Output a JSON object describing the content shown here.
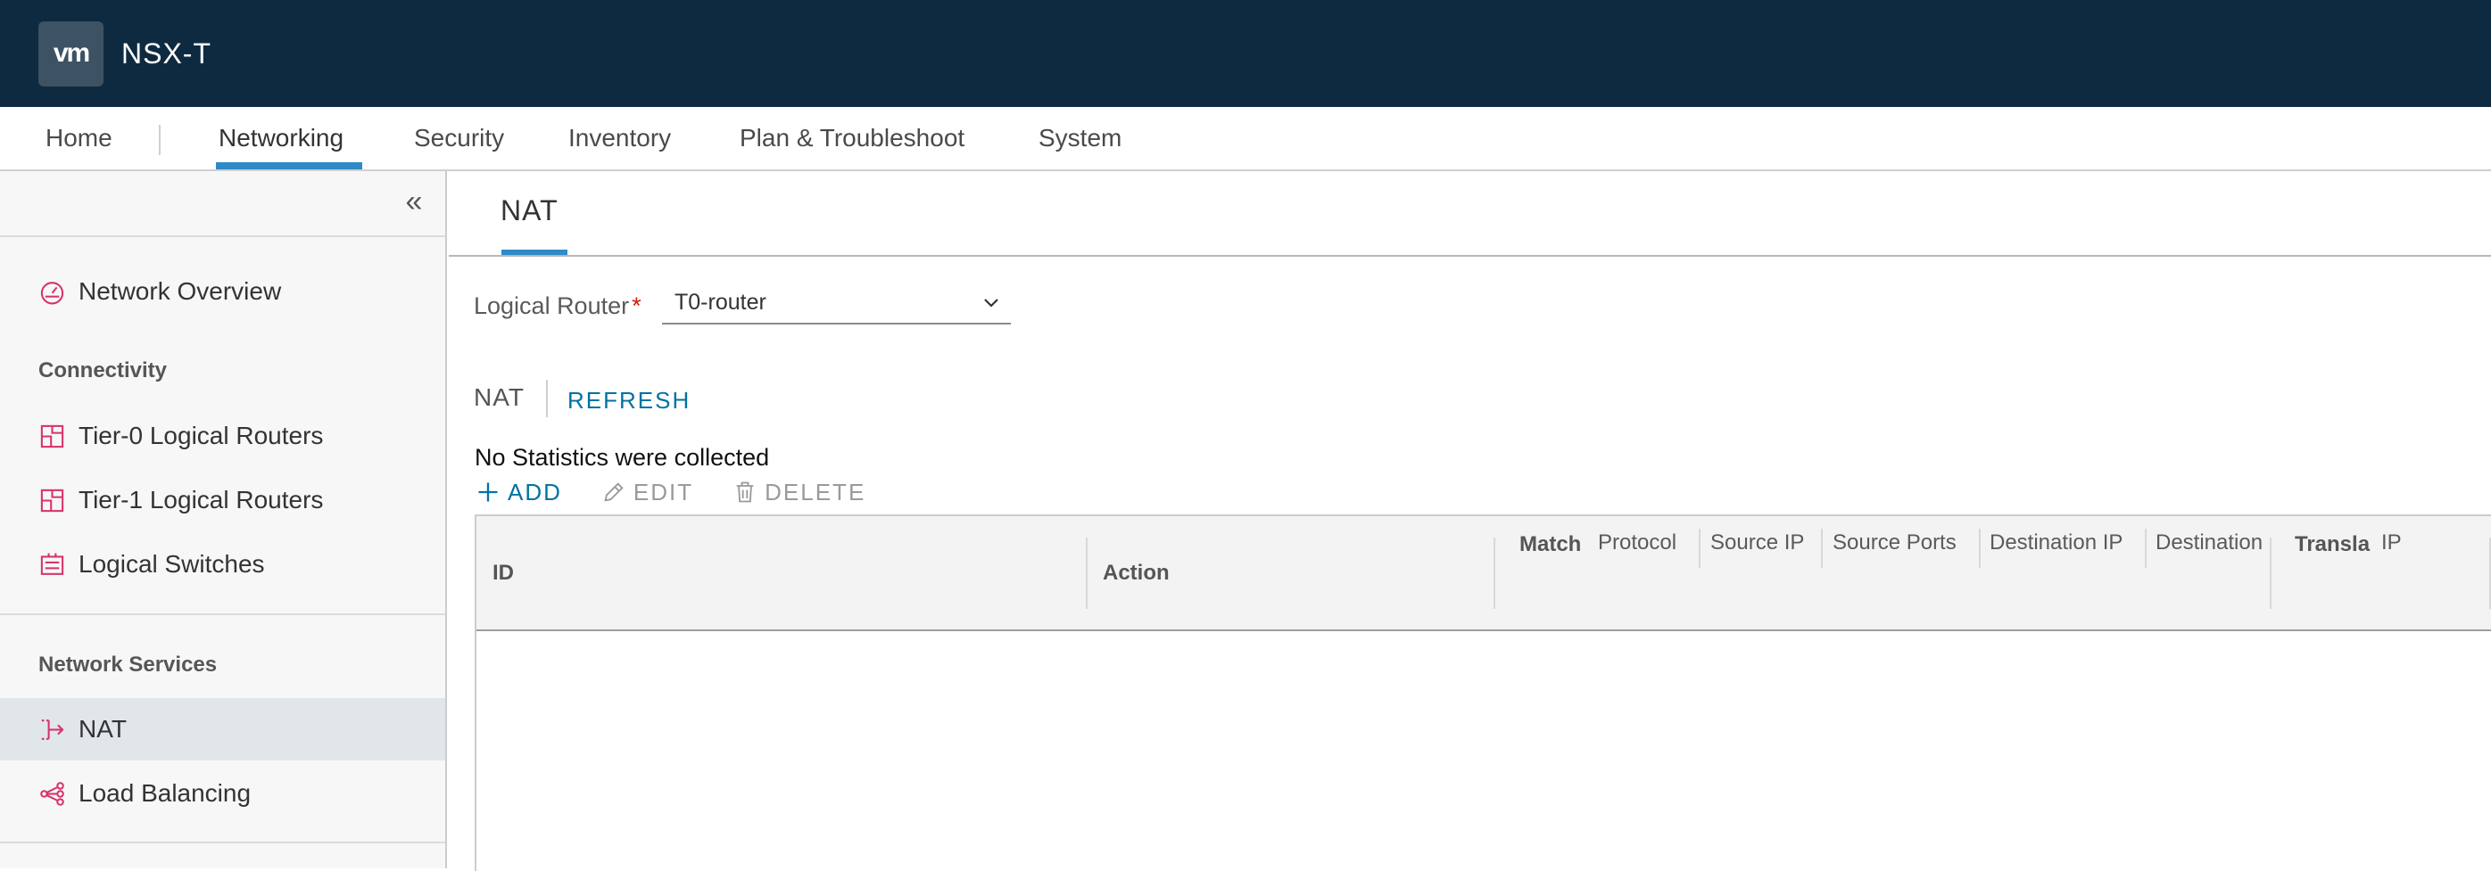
{
  "header": {
    "logo_text": "vm",
    "product": "NSX-T"
  },
  "topnav": {
    "items": [
      {
        "label": "Home"
      },
      {
        "label": "Networking"
      },
      {
        "label": "Security"
      },
      {
        "label": "Inventory"
      },
      {
        "label": "Plan & Troubleshoot"
      },
      {
        "label": "System"
      }
    ],
    "active": "Networking"
  },
  "sidebar": {
    "overview": "Network Overview",
    "connectivity_heading": "Connectivity",
    "connectivity_items": [
      "Tier-0 Logical Routers",
      "Tier-1 Logical Routers",
      "Logical Switches"
    ],
    "services_heading": "Network Services",
    "services_items": [
      "NAT",
      "Load Balancing"
    ],
    "selected": "NAT"
  },
  "content": {
    "tab": "NAT",
    "logical_router_label": "Logical Router",
    "required_mark": "*",
    "logical_router_value": "T0-router",
    "section_label": "NAT",
    "refresh_label": "REFRESH",
    "stats_message": "No Statistics were collected",
    "toolbar": {
      "add": "ADD",
      "edit": "EDIT",
      "delete": "DELETE"
    },
    "grid": {
      "col_id": "ID",
      "col_action": "Action",
      "match_group": "Match",
      "match_cols": [
        "Protocol",
        "Source IP",
        "Source Ports",
        "Destination IP",
        "Destination"
      ],
      "translated_group": "Transla",
      "translated_cols": [
        "IP"
      ]
    }
  },
  "colors": {
    "header_bg": "#0e2a40",
    "accent": "#2f8ac6",
    "link": "#0072a3",
    "icon_pink": "#d6336c"
  }
}
